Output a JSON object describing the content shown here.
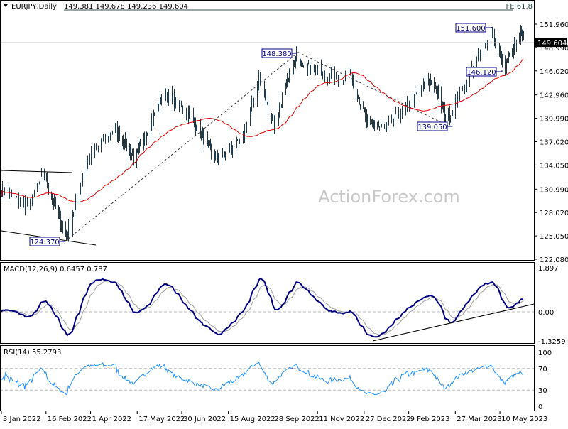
{
  "header": {
    "symbol": "EURJPY,Daily",
    "ohlc": "149.381 149.678 149.236 149.604",
    "fe_label": "FE 61.8"
  },
  "watermark": "ActionForex.com",
  "colors": {
    "bars": "#1f3b4d",
    "ma": "#e00000",
    "macd": "#000080",
    "signal": "#a0a0a0",
    "rsi": "#1e90ff",
    "annotation": "#000080"
  },
  "chart_data": [
    {
      "type": "ohlc",
      "title": "EURJPY,Daily",
      "ylim": [
        122.08,
        151.96
      ],
      "y_ticks": [
        "151.960",
        "148.990",
        "146.020",
        "142.960",
        "139.990",
        "137.020",
        "134.050",
        "130.990",
        "128.020",
        "125.050",
        "122.080"
      ],
      "last_price": "149.604",
      "x_ticks": [
        "3 Jan 2022",
        "16 Feb 2022",
        "1 Apr 2022",
        "17 May 2022",
        "30 Jun 2022",
        "15 Aug 2022",
        "28 Sep 2022",
        "11 Nov 2022",
        "27 Dec 2022",
        "9 Feb 2023",
        "27 Mar 2023",
        "10 May 2023"
      ],
      "approx_closes": [
        [
          "2022-01-03",
          130.85
        ],
        [
          "2022-01-30",
          128.85
        ],
        [
          "2022-02-13",
          132.9
        ],
        [
          "2022-03-08",
          124.8
        ],
        [
          "2022-03-27",
          134.3
        ],
        [
          "2022-04-24",
          138.8
        ],
        [
          "2022-05-15",
          134.7
        ],
        [
          "2022-06-12",
          143.3
        ],
        [
          "2022-07-06",
          140.6
        ],
        [
          "2022-08-03",
          134.7
        ],
        [
          "2022-08-28",
          137.0
        ],
        [
          "2022-09-14",
          145.1
        ],
        [
          "2022-09-28",
          139.2
        ],
        [
          "2022-10-21",
          147.8
        ],
        [
          "2022-11-20",
          145.1
        ],
        [
          "2022-12-14",
          145.5
        ],
        [
          "2022-12-30",
          139.2
        ],
        [
          "2023-01-18",
          138.8
        ],
        [
          "2023-02-11",
          142.0
        ],
        [
          "2023-03-04",
          145.1
        ],
        [
          "2023-03-18",
          139.7
        ],
        [
          "2023-04-08",
          145.1
        ],
        [
          "2023-05-02",
          151.0
        ],
        [
          "2023-05-14",
          146.5
        ],
        [
          "2023-05-30",
          150.5
        ],
        [
          "2023-06-02",
          149.6
        ]
      ],
      "annotations": [
        {
          "label": "124.370",
          "price": 124.37,
          "date": "2022-03-07"
        },
        {
          "label": "148.380",
          "price": 148.38,
          "date": "2022-10-21"
        },
        {
          "label": "151.600",
          "price": 151.6,
          "date": "2023-05-02"
        },
        {
          "label": "146.120",
          "price": 146.12,
          "date": "2023-05-12"
        },
        {
          "label": "139.050",
          "price": 139.05,
          "date": "2023-03-24"
        }
      ],
      "moving_average": "red line"
    },
    {
      "type": "line",
      "title": "MACD(12,26,9) 0.6457 0.787",
      "ylim": [
        -1.3259,
        1.897
      ],
      "y_ticks": [
        "1.897",
        "0.00",
        "-1.3259"
      ]
    },
    {
      "type": "line",
      "title": "RSI(14) 55.2793",
      "ylim": [
        0,
        100
      ],
      "y_ticks": [
        "100",
        "70",
        "30",
        "0"
      ],
      "levels": [
        70,
        30
      ]
    }
  ]
}
